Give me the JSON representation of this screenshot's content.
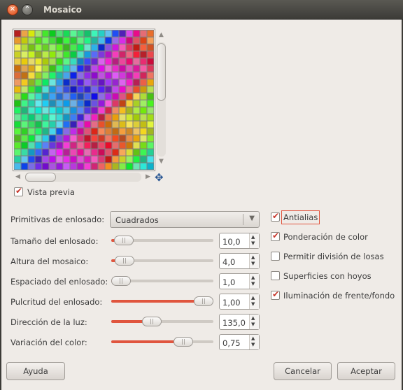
{
  "window": {
    "title": "Mosaico"
  },
  "checkboxes": {
    "preview": {
      "label": "Vista previa",
      "checked": true
    },
    "antialias": {
      "label": "Antialias",
      "checked": true
    },
    "color_weighting": {
      "label": "Ponderación de color",
      "checked": true
    },
    "tile_split": {
      "label": "Permitir división de losas",
      "checked": false
    },
    "pitted": {
      "label": "Superficies con hoyos",
      "checked": false
    },
    "fg_bg_light": {
      "label": "Iluminación de frente/fondo",
      "checked": true
    }
  },
  "primitives": {
    "label": "Primitivas de enlosado:",
    "value": "Cuadrados"
  },
  "params": [
    {
      "label": "Tamaño del enlosado:",
      "value": "10,0",
      "fraction": 0.03
    },
    {
      "label": "Altura del mosaico:",
      "value": "4,0",
      "fraction": 0.04
    },
    {
      "label": "Espaciado del enlosado:",
      "value": "1,0",
      "fraction": 0.0
    },
    {
      "label": "Pulcritud del enlosado:",
      "value": "1,00",
      "fraction": 1.0
    },
    {
      "label": "Dirección de la luz:",
      "value": "135,0",
      "fraction": 0.375
    },
    {
      "label": "Variación del color:",
      "value": "0,75",
      "fraction": 0.75
    }
  ],
  "buttons": {
    "help": "Ayuda",
    "cancel": "Cancelar",
    "accept": "Aceptar"
  },
  "colors": {
    "accent": "#e0553e",
    "window_bg": "#efebe7",
    "titlebar": "#3c3b37"
  },
  "icons": {
    "nav": "navigate-icon"
  }
}
